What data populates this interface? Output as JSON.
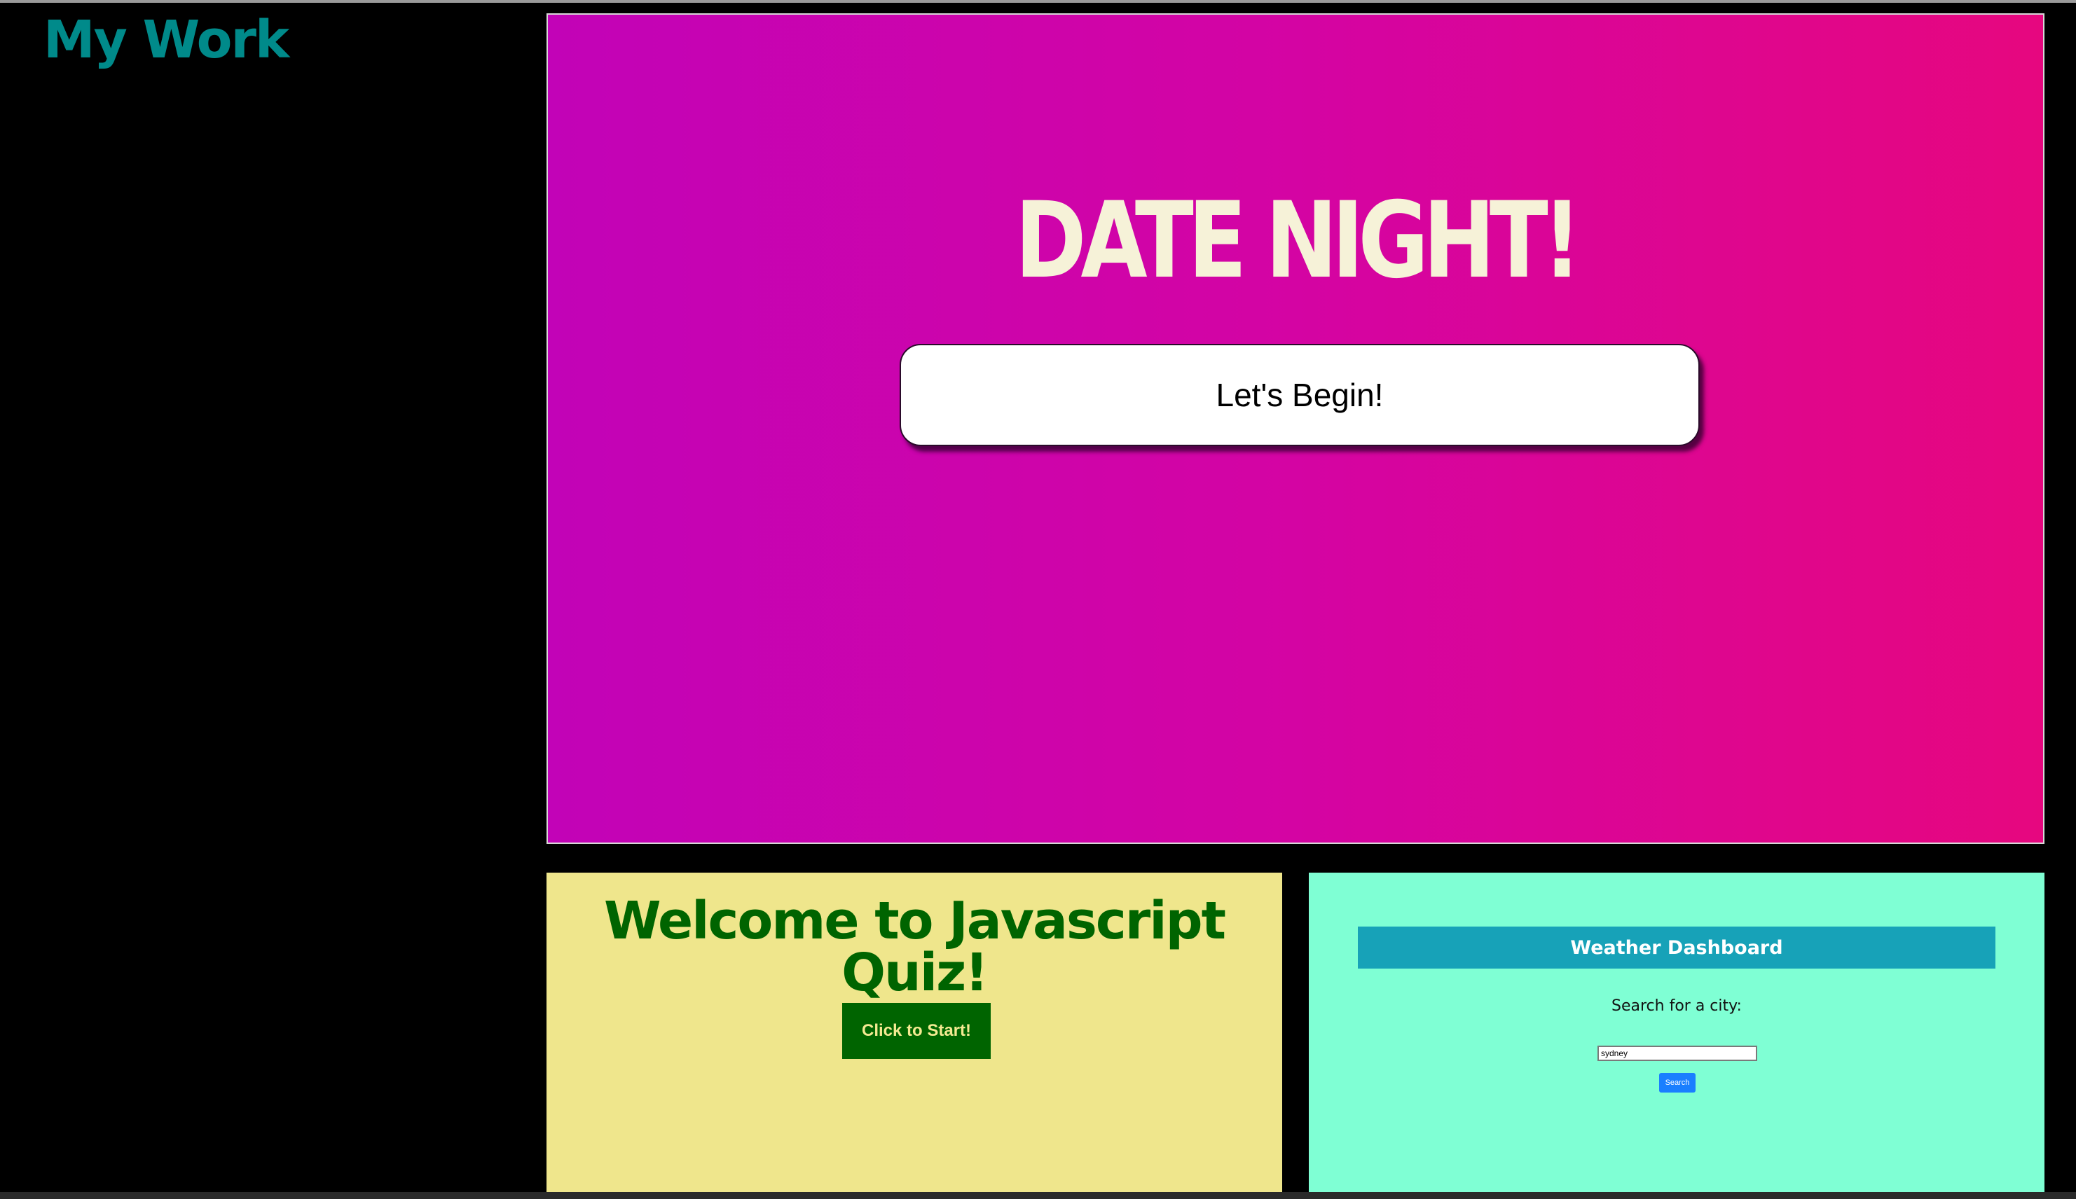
{
  "portfolio": {
    "title": "My Work"
  },
  "projects": {
    "date_night": {
      "heading": "DATE NIGHT!",
      "button_label": "Let's Begin!",
      "gradient_start": "#c203b7",
      "gradient_end": "#e6077f"
    },
    "quiz": {
      "heading": "Welcome to Javascript Quiz!",
      "button_label": "Click to Start!",
      "background": "#efe68c",
      "accent": "#006400"
    },
    "weather": {
      "header": "Weather Dashboard",
      "search_label": "Search for a city:",
      "input_value": "sydney",
      "button_label": "Search",
      "background": "#7fffd4",
      "header_color": "#17a2b8"
    }
  }
}
